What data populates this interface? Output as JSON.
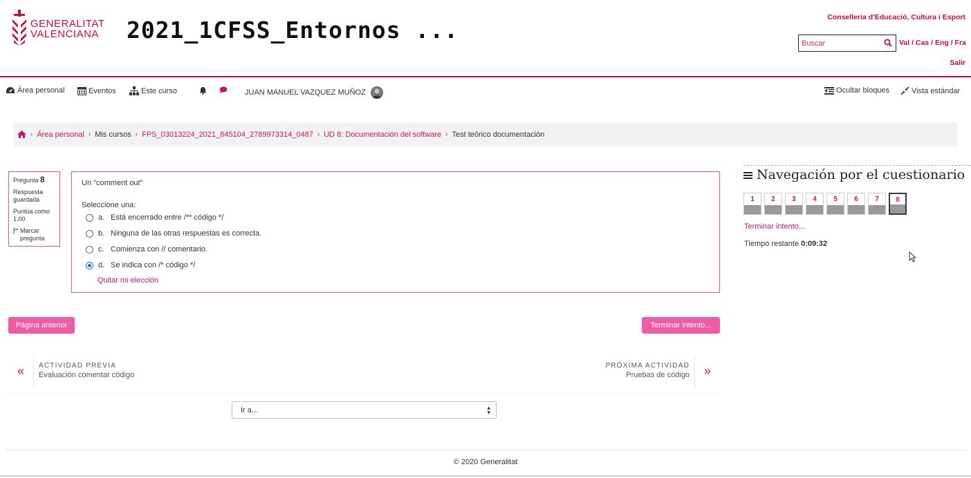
{
  "header": {
    "logo_line1": "GENERALITAT",
    "logo_line2": "VALENCIANA",
    "site_title": "2021_1CFSS_Entornos ...",
    "conselleria": "Conselleria d'Educació, Cultura i Esport",
    "search_placeholder": "Buscar",
    "langs": "Val / Cas / Eng / Fra",
    "salir": "Salir"
  },
  "nav": {
    "area_personal": "Área personal",
    "eventos": "Eventos",
    "este_curso": "Este curso",
    "user_name": "JUAN MANUEL VAZQUEZ MUÑOZ",
    "ocultar_bloques": "Ocultar bloques",
    "vista_estandar": "Vista estándar"
  },
  "breadcrumb": {
    "items": [
      "Área personal",
      "Mis cursos",
      "FPS_03013224_2021_845104_2789973314_0487",
      "UD 8: Documentación del software",
      "Test teórico documentación"
    ]
  },
  "question": {
    "label": "Pregunta",
    "number": "8",
    "status": "Respuesta guardada",
    "score": "Puntúa como 1,00",
    "flag": "Marcar pregunta",
    "text": "Un \"comment out\"",
    "prompt": "Seleccione una:",
    "answers": [
      {
        "letter": "a.",
        "text": "Está encerrado entre /** código */"
      },
      {
        "letter": "b.",
        "text": "Ninguna de las otras respuestas es correcta."
      },
      {
        "letter": "c.",
        "text": "Comienza con // comentario."
      },
      {
        "letter": "d.",
        "text": "Se indica con /* código */"
      }
    ],
    "selected": "d",
    "clear": "Quitar mi elección"
  },
  "buttons": {
    "prev_page": "Página anterior",
    "finish": "Terminar intento..."
  },
  "activity": {
    "prev_label": "ACTIVIDAD PREVIA",
    "prev_title": "Evaluación comentar código",
    "next_label": "PRÓXIMA ACTIVIDAD",
    "next_title": "Pruebas de código"
  },
  "jump": {
    "value": "Ir a..."
  },
  "footer": {
    "copyright": "© 2020 Generalitat"
  },
  "quiz_nav": {
    "title": "Navegación por el cuestionario",
    "buttons": [
      "1",
      "2",
      "3",
      "4",
      "5",
      "6",
      "7",
      "8"
    ],
    "current": "8",
    "finish_link": "Terminar intento...",
    "time_label": "Tiempo restante",
    "time_value": "0:09:32"
  },
  "colors": {
    "brand": "#c8102e",
    "accent": "#c8176b",
    "button": "#f05ba6"
  }
}
